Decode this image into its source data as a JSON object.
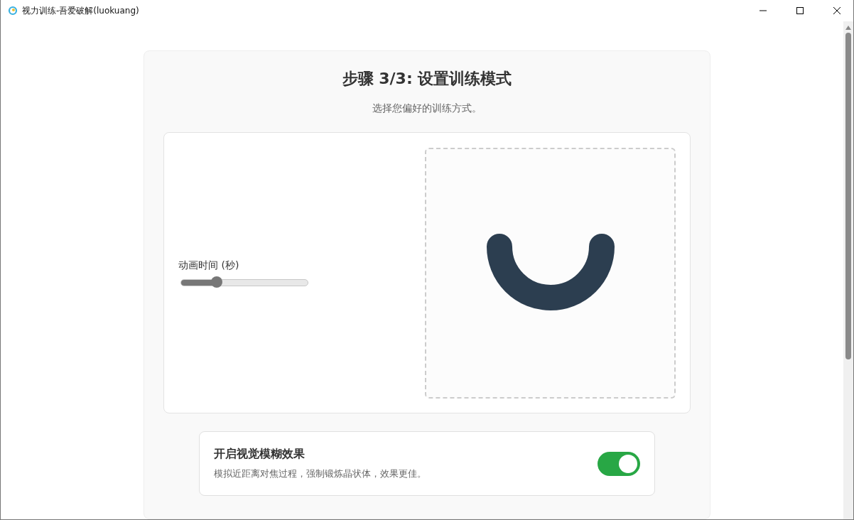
{
  "window": {
    "title": "视力训练-吾爱破解(luokuang)"
  },
  "step": {
    "title": "步骤 3/3: 设置训练模式",
    "subtitle": "选择您偏好的训练方式。"
  },
  "animation": {
    "label": "动画时间 (秒)",
    "level": 0.28
  },
  "blur": {
    "title": "开启视觉模糊效果",
    "description": "模拟近距离对焦过程，强制锻炼晶状体，效果更佳。",
    "on": true
  }
}
